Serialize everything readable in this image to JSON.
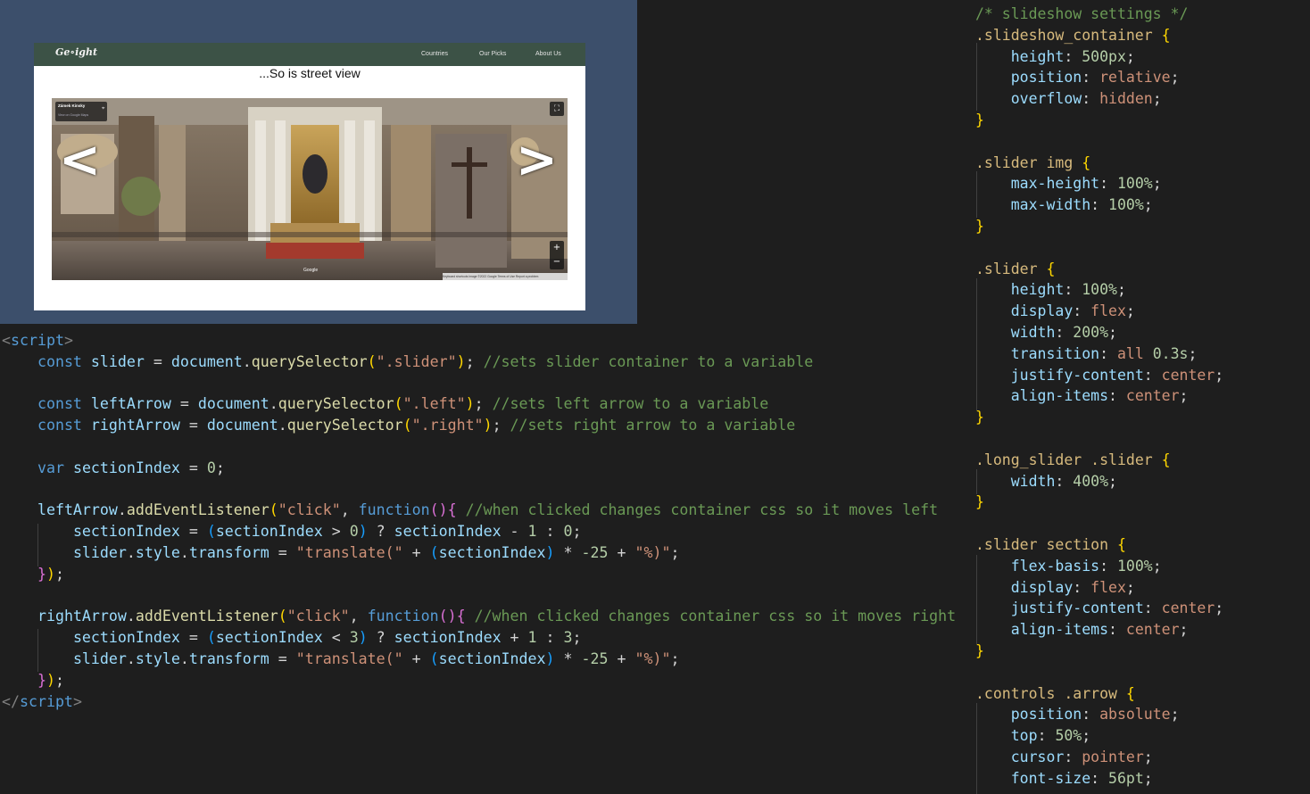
{
  "preview": {
    "logo": "Ge∘ight",
    "nav": [
      "Countries",
      "Our Picks",
      "About Us"
    ],
    "heading": "...So is street view",
    "streetview": {
      "place_title": "Zámek Kinsky",
      "place_link": "View on Google Maps",
      "left_arrow": "<",
      "right_arrow": ">",
      "google_label": "Google",
      "footer": "Keyboard shortcuts  Image ©2022 Google  Terms of Use  Report a problem",
      "zoom_in": "+",
      "zoom_out": "−",
      "fullscreen": "⛶"
    }
  },
  "html_code": {
    "lines": [
      [
        [
          "tag",
          "<"
        ],
        [
          "tagname",
          "script"
        ],
        [
          "tag",
          ">"
        ]
      ],
      [
        [
          "pun",
          "    "
        ],
        [
          "kw",
          "const"
        ],
        [
          "pun",
          " "
        ],
        [
          "var",
          "slider"
        ],
        [
          "pun",
          " = "
        ],
        [
          "var",
          "document"
        ],
        [
          "pun",
          "."
        ],
        [
          "fn",
          "querySelector"
        ],
        [
          "br1",
          "("
        ],
        [
          "str",
          "\".slider\""
        ],
        [
          "br1",
          ")"
        ],
        [
          "pun",
          "; "
        ],
        [
          "cm",
          "//sets slider container to a variable"
        ]
      ],
      [],
      [
        [
          "pun",
          "    "
        ],
        [
          "kw",
          "const"
        ],
        [
          "pun",
          " "
        ],
        [
          "var",
          "leftArrow"
        ],
        [
          "pun",
          " = "
        ],
        [
          "var",
          "document"
        ],
        [
          "pun",
          "."
        ],
        [
          "fn",
          "querySelector"
        ],
        [
          "br1",
          "("
        ],
        [
          "str",
          "\".left\""
        ],
        [
          "br1",
          ")"
        ],
        [
          "pun",
          "; "
        ],
        [
          "cm",
          "//sets left arrow to a variable"
        ]
      ],
      [
        [
          "pun",
          "    "
        ],
        [
          "kw",
          "const"
        ],
        [
          "pun",
          " "
        ],
        [
          "var",
          "rightArrow"
        ],
        [
          "pun",
          " = "
        ],
        [
          "var",
          "document"
        ],
        [
          "pun",
          "."
        ],
        [
          "fn",
          "querySelector"
        ],
        [
          "br1",
          "("
        ],
        [
          "str",
          "\".right\""
        ],
        [
          "br1",
          ")"
        ],
        [
          "pun",
          "; "
        ],
        [
          "cm",
          "//sets right arrow to a variable"
        ]
      ],
      [],
      [
        [
          "pun",
          "    "
        ],
        [
          "kw",
          "var"
        ],
        [
          "pun",
          " "
        ],
        [
          "var",
          "sectionIndex"
        ],
        [
          "pun",
          " = "
        ],
        [
          "num",
          "0"
        ],
        [
          "pun",
          ";"
        ]
      ],
      [],
      [
        [
          "pun",
          "    "
        ],
        [
          "var",
          "leftArrow"
        ],
        [
          "pun",
          "."
        ],
        [
          "fn",
          "addEventListener"
        ],
        [
          "br1",
          "("
        ],
        [
          "str",
          "\"click\""
        ],
        [
          "pun",
          ", "
        ],
        [
          "kw",
          "function"
        ],
        [
          "br2",
          "()"
        ],
        [
          "br2",
          "{"
        ],
        [
          "pun",
          " "
        ],
        [
          "cm",
          "//when clicked changes container css so it moves left"
        ]
      ],
      [
        [
          "pun",
          "        "
        ],
        [
          "var",
          "sectionIndex"
        ],
        [
          "pun",
          " = "
        ],
        [
          "br3",
          "("
        ],
        [
          "var",
          "sectionIndex"
        ],
        [
          "pun",
          " > "
        ],
        [
          "num",
          "0"
        ],
        [
          "br3",
          ")"
        ],
        [
          "pun",
          " ? "
        ],
        [
          "var",
          "sectionIndex"
        ],
        [
          "pun",
          " - "
        ],
        [
          "num",
          "1"
        ],
        [
          "pun",
          " : "
        ],
        [
          "num",
          "0"
        ],
        [
          "pun",
          ";"
        ]
      ],
      [
        [
          "pun",
          "        "
        ],
        [
          "var",
          "slider"
        ],
        [
          "pun",
          "."
        ],
        [
          "var",
          "style"
        ],
        [
          "pun",
          "."
        ],
        [
          "var",
          "transform"
        ],
        [
          "pun",
          " = "
        ],
        [
          "str",
          "\"translate(\""
        ],
        [
          "pun",
          " + "
        ],
        [
          "br3",
          "("
        ],
        [
          "var",
          "sectionIndex"
        ],
        [
          "br3",
          ")"
        ],
        [
          "pun",
          " * "
        ],
        [
          "num",
          "-25"
        ],
        [
          "pun",
          " + "
        ],
        [
          "str",
          "\"%)\""
        ],
        [
          "pun",
          ";"
        ]
      ],
      [
        [
          "pun",
          "    "
        ],
        [
          "br2",
          "}"
        ],
        [
          "br1",
          ")"
        ],
        [
          "pun",
          ";"
        ]
      ],
      [],
      [
        [
          "pun",
          "    "
        ],
        [
          "var",
          "rightArrow"
        ],
        [
          "pun",
          "."
        ],
        [
          "fn",
          "addEventListener"
        ],
        [
          "br1",
          "("
        ],
        [
          "str",
          "\"click\""
        ],
        [
          "pun",
          ", "
        ],
        [
          "kw",
          "function"
        ],
        [
          "br2",
          "()"
        ],
        [
          "br2",
          "{"
        ],
        [
          "pun",
          " "
        ],
        [
          "cm",
          "//when clicked changes container css so it moves right"
        ]
      ],
      [
        [
          "pun",
          "        "
        ],
        [
          "var",
          "sectionIndex"
        ],
        [
          "pun",
          " = "
        ],
        [
          "br3",
          "("
        ],
        [
          "var",
          "sectionIndex"
        ],
        [
          "pun",
          " < "
        ],
        [
          "num",
          "3"
        ],
        [
          "br3",
          ")"
        ],
        [
          "pun",
          " ? "
        ],
        [
          "var",
          "sectionIndex"
        ],
        [
          "pun",
          " + "
        ],
        [
          "num",
          "1"
        ],
        [
          "pun",
          " : "
        ],
        [
          "num",
          "3"
        ],
        [
          "pun",
          ";"
        ]
      ],
      [
        [
          "pun",
          "        "
        ],
        [
          "var",
          "slider"
        ],
        [
          "pun",
          "."
        ],
        [
          "var",
          "style"
        ],
        [
          "pun",
          "."
        ],
        [
          "var",
          "transform"
        ],
        [
          "pun",
          " = "
        ],
        [
          "str",
          "\"translate(\""
        ],
        [
          "pun",
          " + "
        ],
        [
          "br3",
          "("
        ],
        [
          "var",
          "sectionIndex"
        ],
        [
          "br3",
          ")"
        ],
        [
          "pun",
          " * "
        ],
        [
          "num",
          "-25"
        ],
        [
          "pun",
          " + "
        ],
        [
          "str",
          "\"%)\""
        ],
        [
          "pun",
          ";"
        ]
      ],
      [
        [
          "pun",
          "    "
        ],
        [
          "br2",
          "}"
        ],
        [
          "br1",
          ")"
        ],
        [
          "pun",
          ";"
        ]
      ],
      [
        [
          "tag",
          "</"
        ],
        [
          "tagname",
          "script"
        ],
        [
          "tag",
          ">"
        ]
      ]
    ]
  },
  "css_code": {
    "lines": [
      [
        [
          "cm",
          "/* slideshow settings */"
        ]
      ],
      [
        [
          "sel",
          ".slideshow_container"
        ],
        [
          "pun",
          " "
        ],
        [
          "br1",
          "{"
        ]
      ],
      [
        [
          "pun",
          "    "
        ],
        [
          "prop",
          "height"
        ],
        [
          "pun",
          ": "
        ],
        [
          "num",
          "500px"
        ],
        [
          "pun",
          ";"
        ]
      ],
      [
        [
          "pun",
          "    "
        ],
        [
          "prop",
          "position"
        ],
        [
          "pun",
          ": "
        ],
        [
          "val",
          "relative"
        ],
        [
          "pun",
          ";"
        ]
      ],
      [
        [
          "pun",
          "    "
        ],
        [
          "prop",
          "overflow"
        ],
        [
          "pun",
          ": "
        ],
        [
          "val",
          "hidden"
        ],
        [
          "pun",
          ";"
        ]
      ],
      [
        [
          "br1",
          "}"
        ]
      ],
      [],
      [
        [
          "sel",
          ".slider"
        ],
        [
          "pun",
          " "
        ],
        [
          "sel",
          "img"
        ],
        [
          "pun",
          " "
        ],
        [
          "br1",
          "{"
        ]
      ],
      [
        [
          "pun",
          "    "
        ],
        [
          "prop",
          "max-height"
        ],
        [
          "pun",
          ": "
        ],
        [
          "num",
          "100%"
        ],
        [
          "pun",
          ";"
        ]
      ],
      [
        [
          "pun",
          "    "
        ],
        [
          "prop",
          "max-width"
        ],
        [
          "pun",
          ": "
        ],
        [
          "num",
          "100%"
        ],
        [
          "pun",
          ";"
        ]
      ],
      [
        [
          "br1",
          "}"
        ]
      ],
      [],
      [
        [
          "sel",
          ".slider"
        ],
        [
          "pun",
          " "
        ],
        [
          "br1",
          "{"
        ]
      ],
      [
        [
          "pun",
          "    "
        ],
        [
          "prop",
          "height"
        ],
        [
          "pun",
          ": "
        ],
        [
          "num",
          "100%"
        ],
        [
          "pun",
          ";"
        ]
      ],
      [
        [
          "pun",
          "    "
        ],
        [
          "prop",
          "display"
        ],
        [
          "pun",
          ": "
        ],
        [
          "val",
          "flex"
        ],
        [
          "pun",
          ";"
        ]
      ],
      [
        [
          "pun",
          "    "
        ],
        [
          "prop",
          "width"
        ],
        [
          "pun",
          ": "
        ],
        [
          "num",
          "200%"
        ],
        [
          "pun",
          ";"
        ]
      ],
      [
        [
          "pun",
          "    "
        ],
        [
          "prop",
          "transition"
        ],
        [
          "pun",
          ": "
        ],
        [
          "val",
          "all"
        ],
        [
          "pun",
          " "
        ],
        [
          "num",
          "0.3s"
        ],
        [
          "pun",
          ";"
        ]
      ],
      [
        [
          "pun",
          "    "
        ],
        [
          "prop",
          "justify-content"
        ],
        [
          "pun",
          ": "
        ],
        [
          "val",
          "center"
        ],
        [
          "pun",
          ";"
        ]
      ],
      [
        [
          "pun",
          "    "
        ],
        [
          "prop",
          "align-items"
        ],
        [
          "pun",
          ": "
        ],
        [
          "val",
          "center"
        ],
        [
          "pun",
          ";"
        ]
      ],
      [
        [
          "br1",
          "}"
        ]
      ],
      [],
      [
        [
          "sel",
          ".long_slider"
        ],
        [
          "pun",
          " "
        ],
        [
          "sel",
          ".slider"
        ],
        [
          "pun",
          " "
        ],
        [
          "br1",
          "{"
        ]
      ],
      [
        [
          "pun",
          "    "
        ],
        [
          "prop",
          "width"
        ],
        [
          "pun",
          ": "
        ],
        [
          "num",
          "400%"
        ],
        [
          "pun",
          ";"
        ]
      ],
      [
        [
          "br1",
          "}"
        ]
      ],
      [],
      [
        [
          "sel",
          ".slider"
        ],
        [
          "pun",
          " "
        ],
        [
          "sel",
          "section"
        ],
        [
          "pun",
          " "
        ],
        [
          "br1",
          "{"
        ]
      ],
      [
        [
          "pun",
          "    "
        ],
        [
          "prop",
          "flex-basis"
        ],
        [
          "pun",
          ": "
        ],
        [
          "num",
          "100%"
        ],
        [
          "pun",
          ";"
        ]
      ],
      [
        [
          "pun",
          "    "
        ],
        [
          "prop",
          "display"
        ],
        [
          "pun",
          ": "
        ],
        [
          "val",
          "flex"
        ],
        [
          "pun",
          ";"
        ]
      ],
      [
        [
          "pun",
          "    "
        ],
        [
          "prop",
          "justify-content"
        ],
        [
          "pun",
          ": "
        ],
        [
          "val",
          "center"
        ],
        [
          "pun",
          ";"
        ]
      ],
      [
        [
          "pun",
          "    "
        ],
        [
          "prop",
          "align-items"
        ],
        [
          "pun",
          ": "
        ],
        [
          "val",
          "center"
        ],
        [
          "pun",
          ";"
        ]
      ],
      [
        [
          "br1",
          "}"
        ]
      ],
      [],
      [
        [
          "sel",
          ".controls"
        ],
        [
          "pun",
          " "
        ],
        [
          "sel",
          ".arrow"
        ],
        [
          "pun",
          " "
        ],
        [
          "br1",
          "{"
        ]
      ],
      [
        [
          "pun",
          "    "
        ],
        [
          "prop",
          "position"
        ],
        [
          "pun",
          ": "
        ],
        [
          "val",
          "absolute"
        ],
        [
          "pun",
          ";"
        ]
      ],
      [
        [
          "pun",
          "    "
        ],
        [
          "prop",
          "top"
        ],
        [
          "pun",
          ": "
        ],
        [
          "num",
          "50%"
        ],
        [
          "pun",
          ";"
        ]
      ],
      [
        [
          "pun",
          "    "
        ],
        [
          "prop",
          "cursor"
        ],
        [
          "pun",
          ": "
        ],
        [
          "val",
          "pointer"
        ],
        [
          "pun",
          ";"
        ]
      ],
      [
        [
          "pun",
          "    "
        ],
        [
          "prop",
          "font-size"
        ],
        [
          "pun",
          ": "
        ],
        [
          "num",
          "56pt"
        ],
        [
          "pun",
          ";"
        ]
      ]
    ]
  }
}
